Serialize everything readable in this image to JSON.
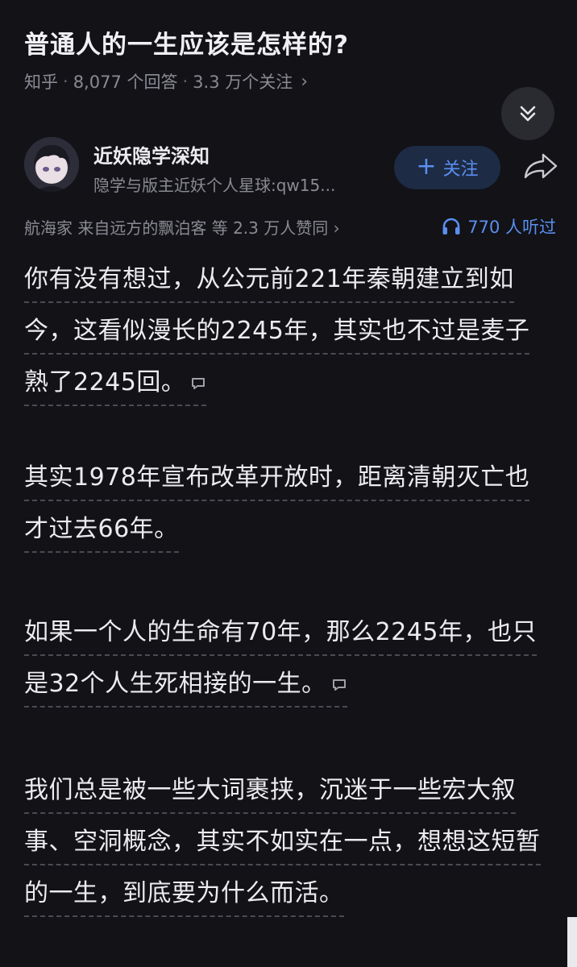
{
  "question": {
    "title": "普通人的一生应该是怎样的?",
    "source": "知乎",
    "answers": "8,077 个回答",
    "followers": "3.3 万个关注"
  },
  "author": {
    "name": "近妖隐学深知",
    "bio": "隐学与版主近妖个人星球:qw15...",
    "follow_label": "关注"
  },
  "stats": {
    "likes": "航海家 来自远方的飘泊客 等 2.3 万人赞同",
    "listens": "770 人听过"
  },
  "paragraphs": [
    [
      "你有没有想过，从公元前221年秦朝建立到如",
      "今，这看似漫长的2245年，其实也不过是麦子",
      "熟了2245回。"
    ],
    [
      "其实1978年宣布改革开放时，距离清朝灭亡也",
      "才过去66年。"
    ],
    [
      "如果一个人的生命有70年，那么2245年，也只",
      "是32个人生死相接的一生。"
    ],
    [
      "我们总是被一些大词裹挟，沉迷于一些宏大叙",
      "事、空洞概念，其实不如实在一点，想想这短暂",
      "的一生，到底要为什么而活。"
    ]
  ],
  "icons": {
    "collapse": "double-chevron-down-icon",
    "share": "share-arrow-icon",
    "headphones": "headphones-icon",
    "comment": "comment-bubble-icon"
  },
  "colors": {
    "background": "#121217",
    "accent": "#5b8ff0",
    "muted": "#8a8a93"
  }
}
